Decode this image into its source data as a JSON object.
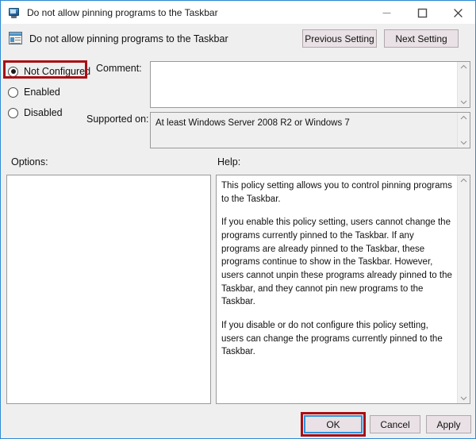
{
  "window": {
    "title": "Do not allow pinning programs to the Taskbar",
    "title_icon": "monitor-icon",
    "border_color": "#2e8ad4",
    "minimize_label": "Minimize",
    "maximize_label": "Maximize",
    "close_label": "Close"
  },
  "header": {
    "icon": "policy-setting-icon",
    "title": "Do not allow pinning programs to the Taskbar",
    "previous_setting_label": "Previous Setting",
    "next_setting_label": "Next Setting"
  },
  "state_options": {
    "selected": "Not Configured",
    "highlight_color": "#a80f14",
    "items": [
      {
        "label": "Not Configured",
        "checked": true
      },
      {
        "label": "Enabled",
        "checked": false
      },
      {
        "label": "Disabled",
        "checked": false
      }
    ]
  },
  "comment": {
    "label": "Comment:",
    "value": "",
    "placeholder": ""
  },
  "supported_on": {
    "label": "Supported on:",
    "value": "At least Windows Server 2008 R2 or Windows 7"
  },
  "options": {
    "label": "Options:",
    "value": ""
  },
  "help": {
    "label": "Help:",
    "paragraphs": [
      "This policy setting allows you to control pinning programs to the Taskbar.",
      "If you enable this policy setting, users cannot change the programs currently pinned to the Taskbar. If any programs are already pinned to the Taskbar, these programs continue to show in the Taskbar. However, users cannot unpin these programs already pinned to the Taskbar, and they cannot pin new programs to the Taskbar.",
      "If you disable or do not configure this policy setting, users can change the programs currently pinned to the Taskbar."
    ]
  },
  "footer": {
    "ok_label": "OK",
    "cancel_label": "Cancel",
    "apply_label": "Apply",
    "ok_focus_color": "#2b95e0",
    "ok_highlight_color": "#a80f14"
  },
  "scrollbars": {
    "up_arrow": "chevron-up-icon",
    "down_arrow": "chevron-down-icon"
  }
}
